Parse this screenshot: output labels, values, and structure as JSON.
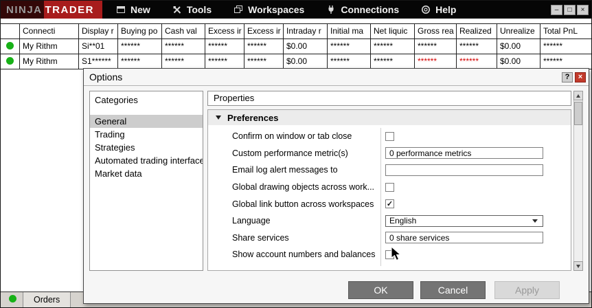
{
  "colors": {
    "accent_red": "#a81c1c",
    "status_green": "#17b117",
    "negative_red": "#d40000"
  },
  "titlebar": {
    "logo_ninja": "NINJA",
    "logo_trader": "TRADER",
    "menus": [
      {
        "label": "New",
        "icon": "new-window-icon"
      },
      {
        "label": "Tools",
        "icon": "tools-icon"
      },
      {
        "label": "Workspaces",
        "icon": "workspaces-icon"
      },
      {
        "label": "Connections",
        "icon": "connections-icon"
      },
      {
        "label": "Help",
        "icon": "help-icon"
      }
    ],
    "window_controls": [
      {
        "name": "minimize",
        "glyph": "–"
      },
      {
        "name": "maximize",
        "glyph": "□"
      },
      {
        "name": "close",
        "glyph": "×"
      }
    ]
  },
  "accounts_table": {
    "columns": [
      "",
      "Connecti",
      "Display r",
      "Buying po",
      "Cash val",
      "Excess ir",
      "Excess ir",
      "Intraday r",
      "Initial ma",
      "Net liquic",
      "Gross rea",
      "Realized",
      "Unrealize",
      "Total PnL"
    ],
    "rows": [
      {
        "status": "connected",
        "cells": [
          "My Rithm",
          "Si**01",
          "******",
          "******",
          "******",
          "******",
          "$0.00",
          "******",
          "******",
          "******",
          "******",
          "$0.00",
          "******"
        ],
        "red_indices": []
      },
      {
        "status": "connected",
        "cells": [
          "My Rithm",
          "S1******",
          "******",
          "******",
          "******",
          "******",
          "$0.00",
          "******",
          "******",
          "******",
          "******",
          "$0.00",
          "******"
        ],
        "red_indices": [
          9,
          10
        ]
      }
    ]
  },
  "dialog": {
    "title": "Options",
    "help_button_label": "?",
    "close_button_glyph": "×",
    "categories": {
      "header": "Categories",
      "items": [
        {
          "label": "General",
          "selected": true
        },
        {
          "label": "Trading",
          "selected": false
        },
        {
          "label": "Strategies",
          "selected": false
        },
        {
          "label": "Automated trading interface",
          "selected": false
        },
        {
          "label": "Market data",
          "selected": false
        }
      ]
    },
    "properties": {
      "header": "Properties",
      "section_label": "Preferences",
      "rows": [
        {
          "label": "Confirm on window or tab close",
          "control": "checkbox",
          "checked": false
        },
        {
          "label": "Custom performance metric(s)",
          "control": "text",
          "value": "0 performance metrics"
        },
        {
          "label": "Email log alert messages to",
          "control": "text",
          "value": ""
        },
        {
          "label": "Global drawing objects across work...",
          "control": "checkbox",
          "checked": false
        },
        {
          "label": "Global link button across workspaces",
          "control": "checkbox",
          "checked": true
        },
        {
          "label": "Language",
          "control": "select",
          "value": "English"
        },
        {
          "label": "Share services",
          "control": "text",
          "value": "0 share services"
        },
        {
          "label": "Show account numbers and balances",
          "control": "checkbox",
          "checked": false
        }
      ]
    },
    "buttons": [
      {
        "label": "OK",
        "enabled": true
      },
      {
        "label": "Cancel",
        "enabled": true
      },
      {
        "label": "Apply",
        "enabled": false
      }
    ]
  },
  "bottom_bar": {
    "tab_label": "Orders",
    "status": "connected"
  }
}
